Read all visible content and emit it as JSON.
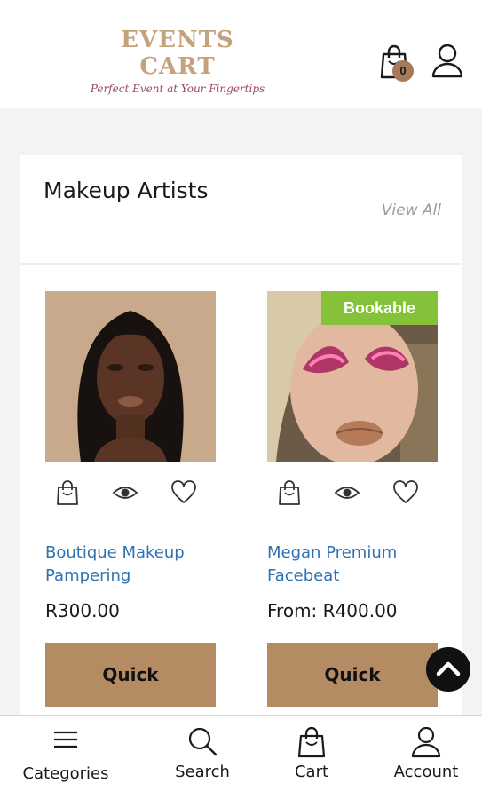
{
  "header": {
    "logo_title": "EVENTS CART",
    "logo_tagline": "Perfect Event at Your Fingertips",
    "cart_count": "0",
    "cart_icon": "shopping-bag-icon",
    "account_icon": "user-icon"
  },
  "section": {
    "title": "Makeup Artists",
    "view_all": "View All"
  },
  "products": [
    {
      "name_line1": "Boutique Makeup",
      "name_line2": "Pampering",
      "price": "R300.00",
      "button": "Quick",
      "badge": ""
    },
    {
      "name_line1": "Megan Premium",
      "name_line2": "Facebeat",
      "price": "From: R400.00",
      "button": "Quick",
      "badge": "Bookable"
    }
  ],
  "product_actions": [
    "shopping-bag-icon",
    "eye-icon",
    "heart-icon"
  ],
  "bottom_nav": [
    {
      "label": "Categories",
      "icon": "menu-icon"
    },
    {
      "label": "Search",
      "icon": "search-icon"
    },
    {
      "label": "Cart",
      "icon": "shopping-bag-icon"
    },
    {
      "label": "Account",
      "icon": "user-icon"
    }
  ],
  "colors": {
    "accent_brown": "#b58b63",
    "link_blue": "#2e72b4",
    "badge_green": "#86c13a",
    "logo_gold": "#c4a27c"
  }
}
